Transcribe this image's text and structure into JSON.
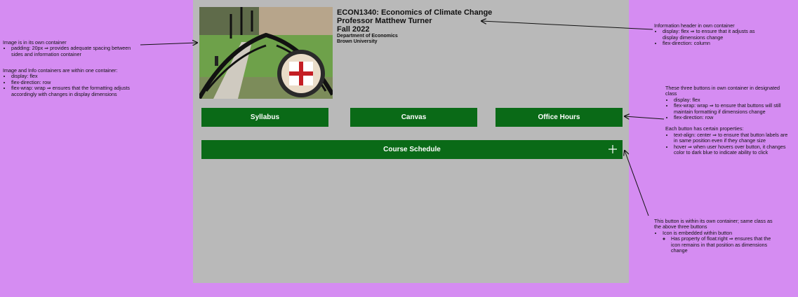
{
  "course": {
    "title": "ECON1340: Economics of Climate Change",
    "professor": "Professor Matthew Turner",
    "term": "Fall 2022",
    "department": "Department of Economics",
    "university": "Brown University"
  },
  "buttons": {
    "syllabus": "Syllabus",
    "canvas": "Canvas",
    "office_hours": "Office Hours",
    "course_schedule": "Course Schedule"
  },
  "icons": {
    "schedule_expand": "plus-icon",
    "photo": "brown-gate-seal-photo"
  },
  "colors": {
    "background": "#d58cf2",
    "panel": "#b9b9b9",
    "button": "#0a6a17",
    "button_hover": "#0b2e6a"
  },
  "annotations": {
    "image": {
      "line1": "Image is in its own container",
      "bullet1": "padding: 20px ⇒ provides adequate spacing between sides and information container"
    },
    "containers": {
      "line1": "Image and Info containers are within one container:",
      "bullets": [
        "display: flex",
        "flex-direction: row",
        "flex-wrap: wrap ⇒ ensures that the formatting adjusts accordingly with changes in display dimensions"
      ]
    },
    "header": {
      "line1": "Information header in own container",
      "bullets": [
        "display: flex ⇒ to ensure that it adjusts as display dimensions change",
        "flex-direction: column"
      ]
    },
    "three_buttons": {
      "line1": "These three buttons in own container in designated class",
      "bullets": [
        "display: flex",
        "flex-wrap: wrap ⇒ to ensure that buttons will still maintain formatting if dimensions change",
        "flex-direction: row"
      ],
      "line2": "Each button has certain properties:",
      "bullets2": [
        "text-align: center ⇒ to ensure that button labels are in same position even if they change size",
        "hover ⇒ when user hovers over button, it changes color to dark blue to indicate ability to click"
      ]
    },
    "schedule_button": {
      "line1": "This button is within its own container; same class as the above three buttons",
      "bullet1": "Icon is embedded within button",
      "sub1": "Has property of float:right ⇒ ensures that the icon remains in that position as dimensions change"
    }
  }
}
